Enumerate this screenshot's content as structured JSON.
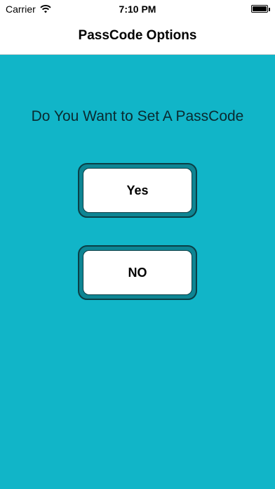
{
  "status_bar": {
    "carrier": "Carrier",
    "time": "7:10 PM",
    "wifi_icon": "wifi-icon",
    "battery_icon": "battery-full-icon"
  },
  "nav": {
    "title": "PassCode Options"
  },
  "main": {
    "question": "Do You Want to Set A PassCode",
    "yes_label": "Yes",
    "no_label": "NO"
  },
  "colors": {
    "background": "#11b5c8",
    "button_border": "#0a3f46",
    "button_fill": "#ffffff"
  }
}
